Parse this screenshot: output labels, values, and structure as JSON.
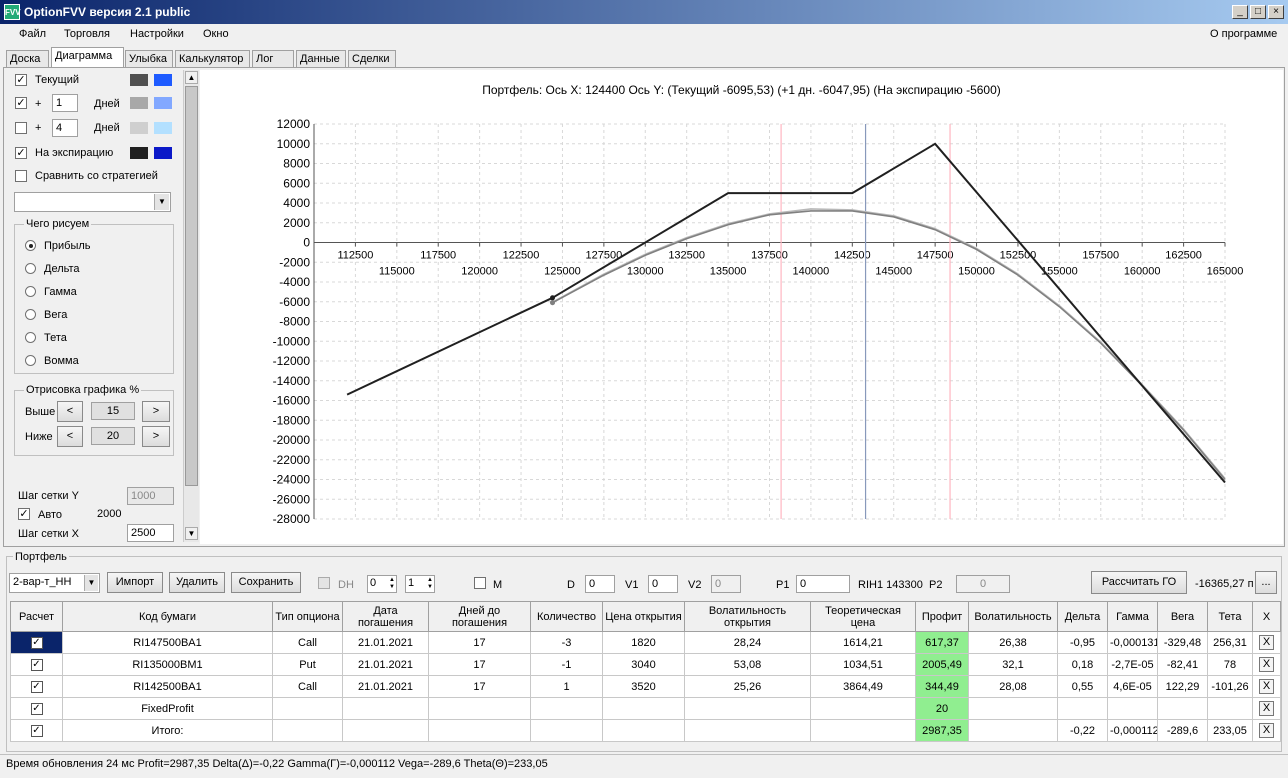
{
  "window": {
    "title": "OptionFVV версия 2.1 public",
    "icon": "FVV"
  },
  "menu": {
    "items": [
      "Файл",
      "Торговля",
      "Настройки",
      "Окно"
    ],
    "about": "О программе"
  },
  "tabs": [
    "Доска",
    "Диаграмма",
    "Улыбка",
    "Калькулятор",
    "Лог",
    "Данные",
    "Сделки"
  ],
  "left": {
    "current_label": "Текущий",
    "plus": "+",
    "days1_value": "1",
    "days_label": "Дней",
    "days2_value": "4",
    "expiry_label": "На экспирацию",
    "compare_label": "Сравнить со стратегией",
    "what_group": "Чего рисуем",
    "radios": [
      "Прибыль",
      "Дельта",
      "Гамма",
      "Вега",
      "Тета",
      "Вомма"
    ],
    "draw_group": "Отрисовка графика %",
    "above_label": "Выше",
    "above_value": "15",
    "below_label": "Ниже",
    "below_value": "20",
    "prev": "<",
    "next": ">",
    "grid_y_label": "Шаг сетки Y",
    "grid_y_value": "1000",
    "auto_label": "Авто",
    "auto_value": "2000",
    "grid_x_label": "Шаг сетки X",
    "grid_x_value": "2500"
  },
  "colors": {
    "current_dark": "#505050",
    "current_light": "#1e5bff",
    "d1_dark": "#a8a8a8",
    "d1_light": "#82a8ff",
    "d2_dark": "#cfcfcf",
    "d2_light": "#b3e0ff",
    "exp_dark": "#202020",
    "exp_light": "#0b19c8",
    "profit_bg": "#90ee90"
  },
  "chart_header": "Портфель: Ось X: 124400 Ось Y:  (Текущий -6095,53)  (+1 дн. -6047,95)  (На экспирацию -5600)",
  "chart_data": {
    "type": "line",
    "x_top_ticks": [
      "112500",
      "117500",
      "122500",
      "127500",
      "132500",
      "137500",
      "142500",
      "147500",
      "152500",
      "157500",
      "162500"
    ],
    "x_bottom_ticks": [
      "115000",
      "120000",
      "125000",
      "130000",
      "135000",
      "140000",
      "145000",
      "150000",
      "155000",
      "160000",
      "165000"
    ],
    "y_ticks": [
      "12000",
      "10000",
      "8000",
      "6000",
      "4000",
      "2000",
      "0",
      "-2000",
      "-4000",
      "-6000",
      "-8000",
      "-10000",
      "-12000",
      "-14000",
      "-16000",
      "-18000",
      "-20000",
      "-22000",
      "-24000",
      "-26000",
      "-28000"
    ],
    "xlim": [
      110000,
      165000
    ],
    "ylim": [
      -28000,
      12000
    ],
    "grid": true,
    "vlines": [
      {
        "x": 138200,
        "color": "#ffb6c1"
      },
      {
        "x": 143300,
        "color": "#8899bb"
      },
      {
        "x": 148400,
        "color": "#ffb6c1"
      }
    ],
    "series": [
      {
        "color": "#202020",
        "x": [
          112000,
          124400,
          135000,
          142500,
          147500,
          165000
        ],
        "y": [
          -15400,
          -5600,
          5000,
          5000,
          10000,
          -24300
        ]
      },
      {
        "color": "#808080",
        "x": [
          124400,
          127500,
          130000,
          132500,
          135000,
          137500,
          140000,
          142500,
          145000,
          147500,
          150000,
          152500,
          155000,
          157500,
          160000,
          162500,
          165000
        ],
        "y": [
          -6096,
          -3300,
          -1300,
          400,
          1800,
          2800,
          3200,
          3200,
          2600,
          1300,
          -700,
          -3300,
          -6500,
          -10200,
          -14500,
          -19000,
          -24000
        ]
      },
      {
        "color": "#b8b8b8",
        "x": [
          124400,
          127500,
          130000,
          132500,
          135000,
          137500,
          140000,
          142500,
          145000,
          147500,
          150000,
          152500,
          155000,
          157500,
          160000,
          162500,
          165000
        ],
        "y": [
          -6048,
          -3200,
          -1200,
          500,
          1900,
          2900,
          3400,
          3300,
          2700,
          1400,
          -600,
          -3200,
          -6400,
          -10100,
          -14400,
          -18900,
          -23900
        ]
      }
    ]
  },
  "portfolio": {
    "group": "Портфель",
    "strategy": "2-вар-т_НН",
    "import": "Импорт",
    "delete": "Удалить",
    "save": "Сохранить",
    "dh": "DH",
    "dh_v1": "0",
    "dh_v2": "1",
    "m": "M",
    "d_label": "D",
    "d_value": "0",
    "v1_label": "V1",
    "v1_value": "0",
    "v2_label": "V2",
    "v2_value": "0",
    "p1_label": "P1",
    "p1_value": "0",
    "rih": "RIH1 143300",
    "p2_label": "P2",
    "p2_value": "0",
    "calc_go": "Рассчитать ГО",
    "go_value": "-16365,27 п",
    "go_more": "..."
  },
  "table": {
    "headers": [
      "Расчет",
      "Код бумаги",
      "Тип опциона",
      "Дата погашения",
      "Дней до погашения",
      "Количество",
      "Цена открытия",
      "Волатильность открытия",
      "Теоретическая цена",
      "Профит",
      "Волатильность",
      "Дельта",
      "Гамма",
      "Вега",
      "Тета",
      "X"
    ],
    "rows": [
      [
        "RI147500BA1",
        "Call",
        "21.01.2021",
        "17",
        "-3",
        "1820",
        "28,24",
        "1614,21",
        "617,37",
        "26,38",
        "-0,95",
        "-0,000131",
        "-329,48",
        "256,31"
      ],
      [
        "RI135000BM1",
        "Put",
        "21.01.2021",
        "17",
        "-1",
        "3040",
        "53,08",
        "1034,51",
        "2005,49",
        "32,1",
        "0,18",
        "-2,7E-05",
        "-82,41",
        "78"
      ],
      [
        "RI142500BA1",
        "Call",
        "21.01.2021",
        "17",
        "1",
        "3520",
        "25,26",
        "3864,49",
        "344,49",
        "28,08",
        "0,55",
        "4,6E-05",
        "122,29",
        "-101,26"
      ],
      [
        "FixedProfit",
        "",
        "",
        "",
        "",
        "",
        "",
        "",
        "20",
        "",
        "",
        "",
        "",
        ""
      ],
      [
        "Итого:",
        "",
        "",
        "",
        "",
        "",
        "",
        "",
        "2987,35",
        "",
        "-0,22",
        "-0,000112",
        "-289,6",
        "233,05"
      ]
    ],
    "close_glyph": "X",
    "check_glyph": "✓"
  },
  "status": "Время обновления 24 мс  Profit=2987,35 Delta(Δ)=-0,22 Gamma(Γ)=-0,000112 Vega=-289,6 Theta(Θ)=233,05"
}
